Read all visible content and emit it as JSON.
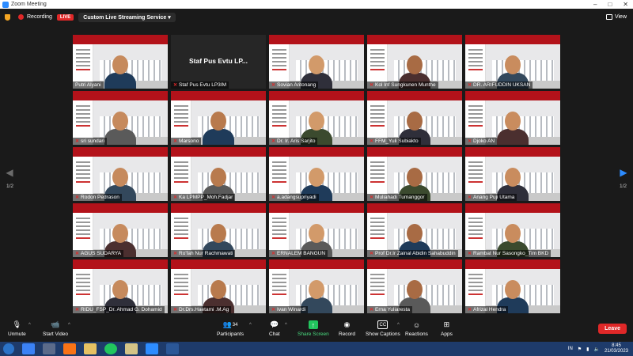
{
  "window": {
    "title": "Zoom Meeting"
  },
  "topbar": {
    "recording_label": "Recording",
    "live_label": "LIVE",
    "stream_label": "Custom Live Streaming Service ▾",
    "view_label": "View"
  },
  "tiles": [
    {
      "name": "Putri Alyani",
      "active": true
    },
    {
      "name": "Staf Pus Evtu LP3IM",
      "blank": true,
      "display": "Staf Pus Evtu LP...",
      "muted": true
    },
    {
      "name": "Sovian Aritonang",
      "muted": true
    },
    {
      "name": "Kol Inf Sungkunen Munthe",
      "muted": true
    },
    {
      "name": "DR. ARIFUDDIN UKSAN",
      "muted": true
    },
    {
      "name": "sri sundari",
      "muted": true
    },
    {
      "name": "Marsono",
      "muted": true
    },
    {
      "name": "Dr. Ir. Aris Sarjito",
      "muted": true
    },
    {
      "name": "FFM_Yuli Subiakto",
      "muted": true
    },
    {
      "name": "Djoko AN",
      "muted": true
    },
    {
      "name": "Rodon Pedrason",
      "muted": true
    },
    {
      "name": "Ka LPMPP_Moh.Fadjar",
      "muted": true
    },
    {
      "name": "a.adangsupriyadi",
      "muted": true
    },
    {
      "name": "Muliahadi Tumanggor",
      "muted": true
    },
    {
      "name": "Anang Puji Utama",
      "muted": true
    },
    {
      "name": "AGUS SUDARYA",
      "muted": true
    },
    {
      "name": "Ro'fah Nur Rachmawati",
      "muted": true
    },
    {
      "name": "ERNALEM BANGUN",
      "muted": true
    },
    {
      "name": "Prof Dr.Ir Zainal Abidin Sahabuddin",
      "muted": true
    },
    {
      "name": "Rambat Nur Sasongko_Tim BKD",
      "muted": true
    },
    {
      "name": "RIDU_FSP_Dr. Ahmad G. Dohamid",
      "muted": true
    },
    {
      "name": "Dr.Drs.Haetami .M.Ag",
      "muted": true
    },
    {
      "name": "Ivan Winardi",
      "muted": true
    },
    {
      "name": "Erna Yuliaresta",
      "muted": true
    },
    {
      "name": "Afrizal Hendra",
      "muted": true
    }
  ],
  "pagination": {
    "left": "1/2",
    "right": "1/2"
  },
  "toolbar": {
    "unmute": "Unmute",
    "start_video": "Start Video",
    "participants": "Participants",
    "participant_count": "34",
    "chat": "Chat",
    "share_screen": "Share Screen",
    "record": "Record",
    "show_captions": "Show Captions",
    "reactions": "Reactions",
    "apps": "Apps",
    "leave": "Leave",
    "cc_label": "CC"
  },
  "taskbar": {
    "language": "IN",
    "time": "8:45",
    "date": "21/03/2023"
  },
  "colors": {
    "accent": "#2d8cff",
    "live": "#e02828",
    "active_speaker": "#a6d33a",
    "share": "#22c55e"
  }
}
